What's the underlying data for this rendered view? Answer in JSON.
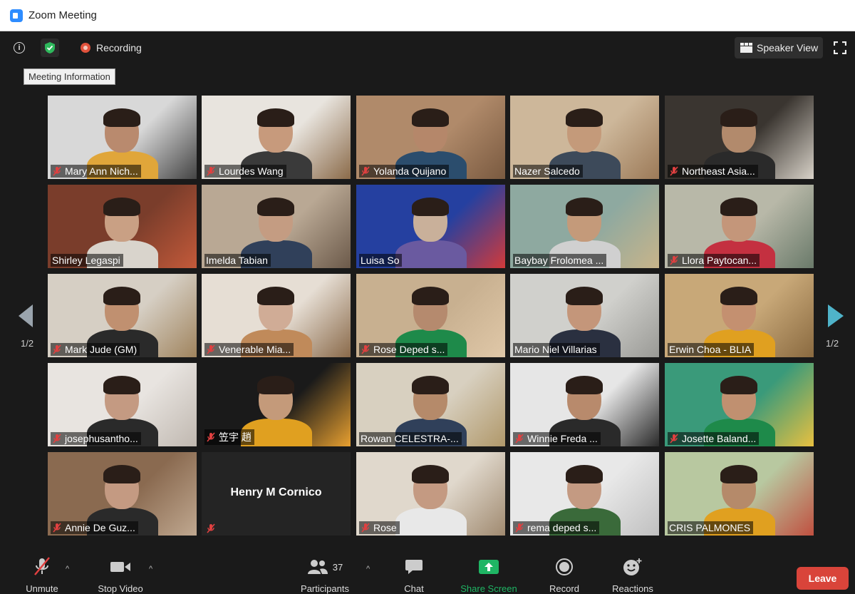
{
  "window": {
    "title": "Zoom Meeting"
  },
  "topbar": {
    "recording_label": "Recording",
    "speaker_view_label": "Speaker View",
    "tooltip": "Meeting Information"
  },
  "pages": {
    "left": "1/2",
    "right": "1/2"
  },
  "participants": [
    {
      "name": "Mary Ann Nich...",
      "muted": true
    },
    {
      "name": "Lourdes Wang",
      "muted": true
    },
    {
      "name": "Yolanda Quijano",
      "muted": true
    },
    {
      "name": "Nazer Salcedo",
      "muted": false
    },
    {
      "name": "Northeast Asia...",
      "muted": true
    },
    {
      "name": "Shirley Legaspi",
      "muted": false
    },
    {
      "name": "Imelda Tabian",
      "muted": false,
      "active": true
    },
    {
      "name": "Luisa So",
      "muted": false
    },
    {
      "name": "Baybay Frolomea ...",
      "muted": false
    },
    {
      "name": "Llora Paytocan...",
      "muted": true
    },
    {
      "name": "Mark Jude (GM)",
      "muted": true
    },
    {
      "name": "Venerable Mia...",
      "muted": true
    },
    {
      "name": "Rose Deped s...",
      "muted": true
    },
    {
      "name": "Mario Niel Villarias",
      "muted": false
    },
    {
      "name": "Erwin Choa - BLIA",
      "muted": false
    },
    {
      "name": "josephusantho...",
      "muted": true
    },
    {
      "name": "笠宇 趙",
      "muted": true
    },
    {
      "name": "Rowan CELESTRA-...",
      "muted": false
    },
    {
      "name": "Winnie Freda ...",
      "muted": true
    },
    {
      "name": "Josette Baland...",
      "muted": true
    },
    {
      "name": "Annie De Guz...",
      "muted": true
    },
    {
      "name": "Henry M Cornico",
      "muted": true,
      "video_off": true
    },
    {
      "name": "Rose",
      "muted": true
    },
    {
      "name": "rema deped s...",
      "muted": true
    },
    {
      "name": "CRIS PALMONES",
      "muted": false
    }
  ],
  "toolbar": {
    "unmute": "Unmute",
    "stop_video": "Stop Video",
    "participants": "Participants",
    "participants_count": "37",
    "chat": "Chat",
    "share_screen": "Share Screen",
    "record": "Record",
    "reactions": "Reactions",
    "leave": "Leave"
  },
  "colors": {
    "share_green": "#1fb564",
    "leave_red": "#d9443a",
    "zoom_blue": "#2d8cff"
  }
}
